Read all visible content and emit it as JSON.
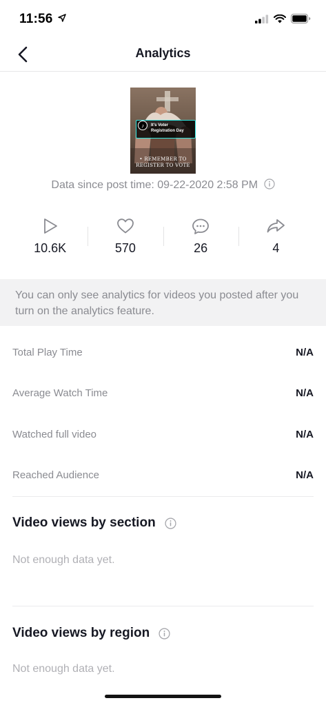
{
  "status_bar": {
    "time": "11:56",
    "icons": [
      "location-arrow-icon",
      "cellular-signal-icon",
      "wifi-icon",
      "battery-icon"
    ]
  },
  "nav": {
    "title": "Analytics",
    "back_icon": "chevron-left-icon"
  },
  "video": {
    "badge_text_line1": "It's Voter",
    "badge_text_line2": "Registration Day",
    "overlay_line1": "• REMEMBER TO",
    "overlay_line2": "REGISTER TO VOTE"
  },
  "data_since": "Data since post time: 09-22-2020 2:58 PM",
  "stats": [
    {
      "icon": "play-icon",
      "value": "10.6K"
    },
    {
      "icon": "heart-icon",
      "value": "570"
    },
    {
      "icon": "comment-icon",
      "value": "26"
    },
    {
      "icon": "share-icon",
      "value": "4"
    }
  ],
  "notice": "You can only see analytics for videos you posted after you turn on the analytics feature.",
  "metrics": [
    {
      "label": "Total Play Time",
      "value": "N/A"
    },
    {
      "label": "Average Watch Time",
      "value": "N/A"
    },
    {
      "label": "Watched full video",
      "value": "N/A"
    },
    {
      "label": "Reached Audience",
      "value": "N/A"
    }
  ],
  "sections": [
    {
      "title": "Video views by section",
      "empty": "Not enough data yet."
    },
    {
      "title": "Video views by region",
      "empty": "Not enough data yet."
    }
  ],
  "colors": {
    "text_primary": "#161823",
    "text_secondary": "#8a8b91",
    "text_muted": "#b0b0b5",
    "notice_bg": "#f2f2f3",
    "badge_border": "#2ee6e0"
  }
}
